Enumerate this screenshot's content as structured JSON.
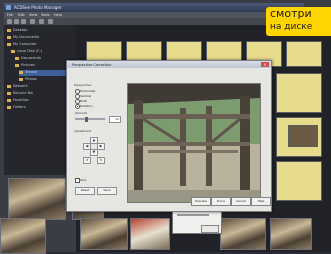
{
  "sticker": {
    "line1": "смотри",
    "line2": "на диске"
  },
  "app": {
    "title": "ACDSee Photo Manager"
  },
  "menu": [
    "File",
    "Edit",
    "View",
    "Tools",
    "Help"
  ],
  "tree": [
    "Desktop",
    "My Documents",
    "My Computer",
    "Local Disk (C:)",
    "Documents",
    "Pictures",
    "Temple",
    "Photos",
    "Network",
    "Recycle Bin",
    "Favorites",
    "Folders"
  ],
  "dialog": {
    "title": "Perspective Correction",
    "group1": "Perspective",
    "options": [
      "Horizontal",
      "Vertical",
      "Both",
      "Rotation"
    ],
    "selected_index": 3,
    "amount_label": "Amount",
    "amount_value": "12",
    "group2": "Adjustment",
    "arrows": [
      "▲",
      "◀",
      "▶",
      "▼",
      "↺",
      "↻"
    ],
    "grid_label": "Grid",
    "reset_label": "Reset",
    "save_label": "Save",
    "buttons": [
      "Preview",
      "Done",
      "Cancel",
      "Help"
    ]
  }
}
